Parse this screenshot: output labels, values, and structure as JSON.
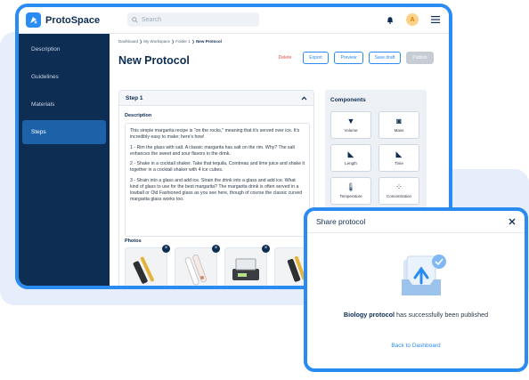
{
  "app": {
    "name": "ProtoSpace"
  },
  "search": {
    "placeholder": "Search"
  },
  "user": {
    "initial": "A"
  },
  "sidebar": {
    "items": [
      {
        "label": "Description",
        "active": false
      },
      {
        "label": "Guidelines",
        "active": false
      },
      {
        "label": "Materials",
        "active": false
      },
      {
        "label": "Steps",
        "active": true
      }
    ]
  },
  "breadcrumb": {
    "items": [
      "Dashboard",
      "My Workspace",
      "Folder 1",
      "New Protocol"
    ]
  },
  "page": {
    "title": "New Protocol"
  },
  "toolbar": {
    "delete": "Delete",
    "export": "Export",
    "preview": "Preview",
    "save_draft": "Save draft",
    "publish": "Publish"
  },
  "step": {
    "title": "Step 1",
    "description_label": "Description",
    "description": [
      "This simple margarita recipe is \"on the rocks,\" meaning that it's served over ice. It's incredibly easy to make; here's how!",
      "1 - Rim the glass with salt. A classic margarita has salt on the rim. Why? The salt enhances the sweet and sour flavors in the drink.",
      "2 - Shake in a cocktail shaker. Take that tequila, Cointreau and lime juice and shake it together in a cocktail shaker with 4 ice cubes.",
      "3 - Strain into a glass and add ice. Strain the drink into a glass and add ice. What kind of glass to use for the best margarita? The margarita drink is often served in a lowball or Old Fashioned glass as you see here, though of course the classic curved margarita glass works too."
    ],
    "photos_label": "Photos"
  },
  "components": {
    "title": "Components",
    "items": [
      {
        "label": "Volume",
        "icon": "beaker-icon"
      },
      {
        "label": "Mass",
        "icon": "weight-icon"
      },
      {
        "label": "Length",
        "icon": "ruler-icon"
      },
      {
        "label": "Time",
        "icon": "clock-icon"
      },
      {
        "label": "Temperature",
        "icon": "thermometer-icon"
      },
      {
        "label": "Concentration",
        "icon": "molecule-icon"
      }
    ]
  },
  "modal": {
    "title": "Share protocol",
    "protocol_name": "Biology protocol",
    "message": "has successfully been published",
    "link": "Back to Dashboard"
  },
  "colors": {
    "accent": "#2a8bf2",
    "sidebar": "#0d2d52",
    "danger": "#e5484d"
  }
}
